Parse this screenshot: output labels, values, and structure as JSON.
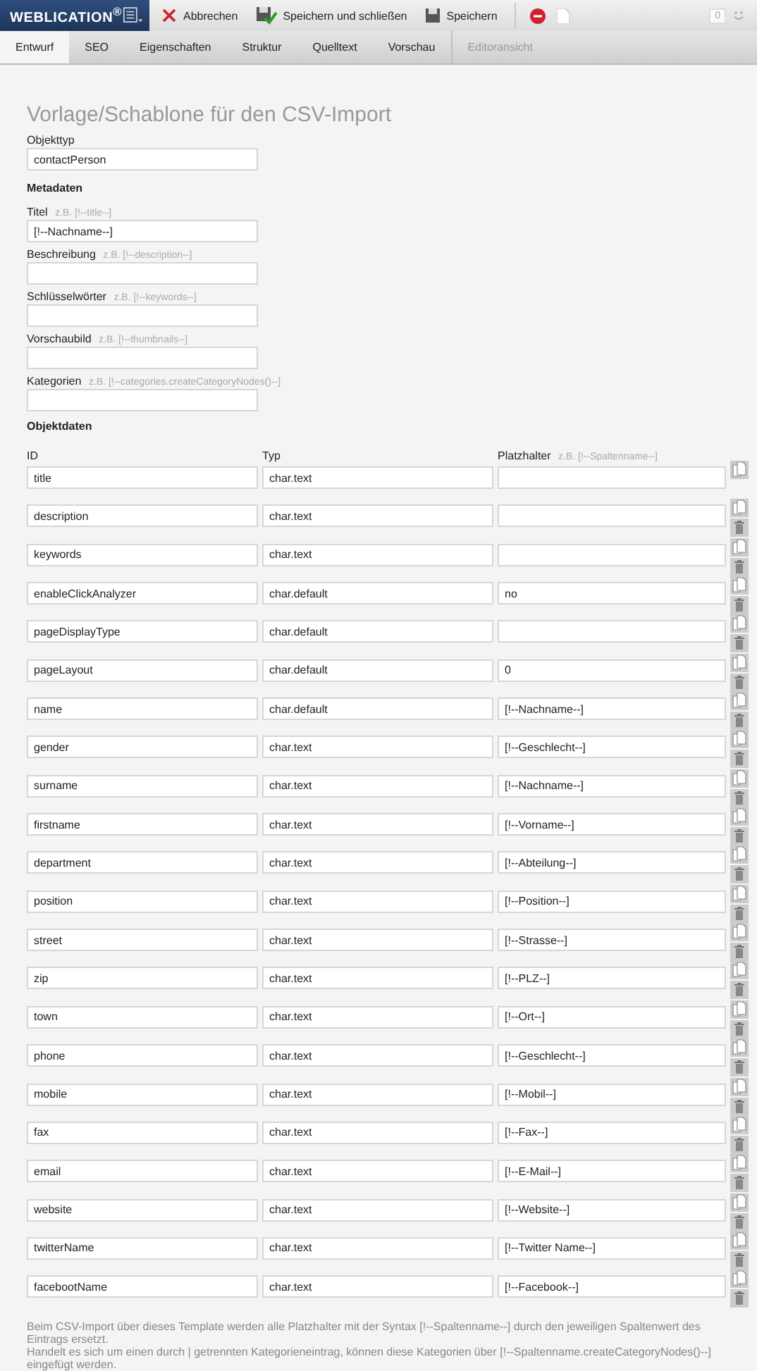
{
  "header": {
    "logo": "WEBLICATION$^{®}$",
    "actions": [
      {
        "kind": "cancel",
        "label": "Abbrechen"
      },
      {
        "kind": "save-close",
        "label": "Speichern und schließen"
      },
      {
        "kind": "save",
        "label": "Speichern"
      }
    ],
    "counter": "0"
  },
  "tabs": [
    {
      "label": "Entwurf",
      "selected": true,
      "disabled": false
    },
    {
      "label": "SEO",
      "selected": false,
      "disabled": false
    },
    {
      "label": "Eigenschaften",
      "selected": false,
      "disabled": false
    },
    {
      "label": "Struktur",
      "selected": false,
      "disabled": false
    },
    {
      "label": "Quelltext",
      "selected": false,
      "disabled": false
    },
    {
      "label": "Vorschau",
      "selected": false,
      "disabled": false
    },
    {
      "label": "Editoransicht",
      "selected": false,
      "disabled": true
    }
  ],
  "page_title": "Vorlage/Schablone für den CSV-Import",
  "object_type": {
    "label": "Objekttyp",
    "value": "contactPerson"
  },
  "metadata": {
    "heading": "Metadaten",
    "fields": [
      {
        "label": "Titel",
        "hint": "z.B. [!--title--]",
        "value": "[!--Nachname--]"
      },
      {
        "label": "Beschreibung",
        "hint": "z.B. [!--description--]"
      },
      {
        "label": "Schlüsselwörter",
        "hint": "z.B. [!--keywords--]"
      },
      {
        "label": "Vorschaubild",
        "hint": "z.B. [!--thumbnails--]"
      },
      {
        "label": "Kategorien",
        "hint": "z.B. [!--categories.createCategoryNodes()--]"
      }
    ]
  },
  "object_data": {
    "heading": "Objektdaten",
    "columns": [
      {
        "label": "ID"
      },
      {
        "label": "Typ"
      },
      {
        "label": "Platzhalter",
        "hint": "z.B. [!--Spaltenname--]"
      }
    ],
    "rows": [
      {
        "id": "title",
        "type": "char.text",
        "deletable": false
      },
      {
        "id": "description",
        "type": "char.text",
        "deletable": true
      },
      {
        "id": "keywords",
        "type": "char.text",
        "deletable": true
      },
      {
        "id": "enableClickAnalyzer",
        "type": "char.default",
        "value": "no",
        "deletable": true
      },
      {
        "id": "pageDisplayType",
        "type": "char.default",
        "deletable": true
      },
      {
        "id": "pageLayout",
        "type": "char.default",
        "value": "0",
        "deletable": true
      },
      {
        "id": "name",
        "type": "char.default",
        "value": "[!--Nachname--]",
        "deletable": true
      },
      {
        "id": "gender",
        "type": "char.text",
        "value": "[!--Geschlecht--]",
        "deletable": true
      },
      {
        "id": "surname",
        "type": "char.text",
        "value": "[!--Nachname--]",
        "deletable": true
      },
      {
        "id": "firstname",
        "type": "char.text",
        "value": "[!--Vorname--]",
        "deletable": true
      },
      {
        "id": "department",
        "type": "char.text",
        "value": "[!--Abteilung--]",
        "deletable": true
      },
      {
        "id": "position",
        "type": "char.text",
        "value": "[!--Position--]",
        "deletable": true
      },
      {
        "id": "street",
        "type": "char.text",
        "value": "[!--Strasse--]",
        "deletable": true
      },
      {
        "id": "zip",
        "type": "char.text",
        "value": "[!--PLZ--]",
        "deletable": true
      },
      {
        "id": "town",
        "type": "char.text",
        "value": "[!--Ort--]",
        "deletable": true
      },
      {
        "id": "phone",
        "type": "char.text",
        "value": "[!--Geschlecht--]",
        "deletable": true
      },
      {
        "id": "mobile",
        "type": "char.text",
        "value": "[!--Mobil--]",
        "deletable": true
      },
      {
        "id": "fax",
        "type": "char.text",
        "value": "[!--Fax--]",
        "deletable": true
      },
      {
        "id": "email",
        "type": "char.text",
        "value": "[!--E-Mail--]",
        "deletable": true
      },
      {
        "id": "website",
        "type": "char.text",
        "value": "[!--Website--]",
        "deletable": true
      },
      {
        "id": "twitterName",
        "type": "char.text",
        "value": "[!--Twitter Name--]",
        "deletable": true
      },
      {
        "id": "facebootName",
        "type": "char.text",
        "value": "[!--Facebook--]",
        "deletable": true
      }
    ]
  },
  "notes": [
    "Beim CSV-Import über dieses Template werden alle Platzhalter mit der Syntax [!--Spaltenname--] durch den jeweiligen Spaltenwert des Eintrags ersetzt.",
    "Handelt es sich um einen durch | getrennten Kategorieneintrag, können diese Kategorien über [!--Spaltenname.createCategoryNodes()--] eingefügt werden."
  ]
}
